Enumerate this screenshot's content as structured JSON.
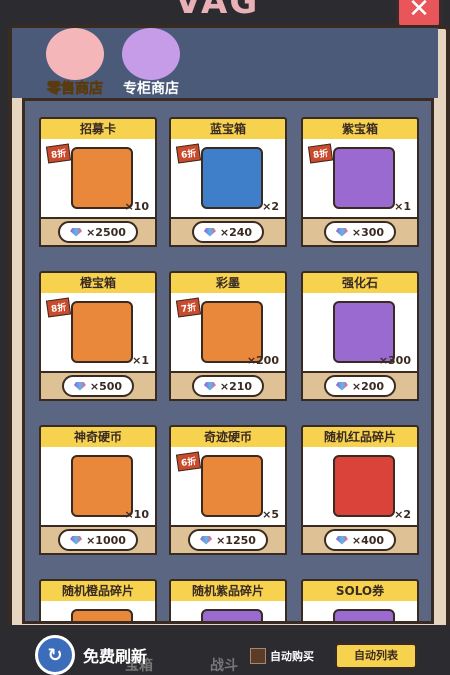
{
  "header": {
    "title_fragment": "VAG"
  },
  "tabs": [
    {
      "label": "零售商店",
      "active": true
    },
    {
      "label": "专柜商店",
      "active": false
    }
  ],
  "items": [
    {
      "title": "招募卡",
      "discount": "8折",
      "qty": "×10",
      "price": "×2500",
      "icon": "recruit-card-icon",
      "color": "#e9873a"
    },
    {
      "title": "蓝宝箱",
      "discount": "6折",
      "qty": "×2",
      "price": "×240",
      "icon": "blue-chest-icon",
      "color": "#3f7fc9"
    },
    {
      "title": "紫宝箱",
      "discount": "8折",
      "qty": "×1",
      "price": "×300",
      "icon": "purple-chest-icon",
      "color": "#9b6ad0"
    },
    {
      "title": "橙宝箱",
      "discount": "8折",
      "qty": "×1",
      "price": "×500",
      "icon": "orange-chest-icon",
      "color": "#e9873a"
    },
    {
      "title": "彩墨",
      "discount": "7折",
      "qty": "×200",
      "price": "×210",
      "icon": "rainbow-ink-icon",
      "color": "#e9873a"
    },
    {
      "title": "强化石",
      "discount": "",
      "qty": "×300",
      "price": "×200",
      "icon": "enhance-stone-icon",
      "color": "#9b6ad0"
    },
    {
      "title": "神奇硬币",
      "discount": "",
      "qty": "×10",
      "price": "×1000",
      "icon": "magic-coin-icon",
      "color": "#e9873a"
    },
    {
      "title": "奇迹硬币",
      "discount": "6折",
      "qty": "×5",
      "price": "×1250",
      "icon": "miracle-coin-icon",
      "color": "#e9873a"
    },
    {
      "title": "随机红品碎片",
      "discount": "",
      "qty": "×2",
      "price": "×400",
      "icon": "red-fragment-icon",
      "color": "#d9433a"
    },
    {
      "title": "随机橙品碎片",
      "discount": "",
      "qty": "",
      "price": "",
      "icon": "orange-fragment-icon",
      "color": "#e9873a"
    },
    {
      "title": "随机紫品碎片",
      "discount": "",
      "qty": "",
      "price": "",
      "icon": "purple-fragment-icon",
      "color": "#9b6ad0"
    },
    {
      "title": "SOLO券",
      "discount": "",
      "qty": "",
      "price": "",
      "icon": "solo-ticket-icon",
      "color": "#9b6ad0"
    }
  ],
  "footer": {
    "refresh_label": "免费刷新",
    "auto_buy_label": "自动购买",
    "auto_list_label": "自动列表",
    "bg_tab_1": "宝箱",
    "bg_tab_2": "战斗"
  }
}
